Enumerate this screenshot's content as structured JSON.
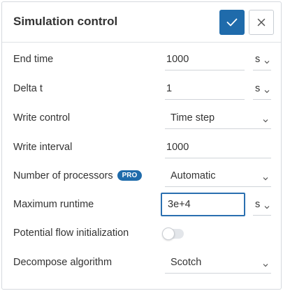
{
  "panel": {
    "title": "Simulation control",
    "confirm_icon": "check-icon",
    "close_icon": "close-icon"
  },
  "fields": {
    "end_time": {
      "label": "End time",
      "value": "1000",
      "unit": "s"
    },
    "delta_t": {
      "label": "Delta t",
      "value": "1",
      "unit": "s"
    },
    "write_control": {
      "label": "Write control",
      "value": "Time step"
    },
    "write_interval": {
      "label": "Write interval",
      "value": "1000"
    },
    "num_processors": {
      "label": "Number of processors",
      "badge": "PRO",
      "value": "Automatic"
    },
    "max_runtime": {
      "label": "Maximum runtime",
      "value": "3e+4",
      "unit": "s"
    },
    "potential_flow": {
      "label": "Potential flow initialization",
      "enabled": false
    },
    "decompose": {
      "label": "Decompose algorithm",
      "value": "Scotch"
    }
  },
  "colors": {
    "accent": "#1f6bab",
    "focus_border": "#2a6fb0",
    "text": "#333333",
    "divider": "#d0d4d9"
  }
}
